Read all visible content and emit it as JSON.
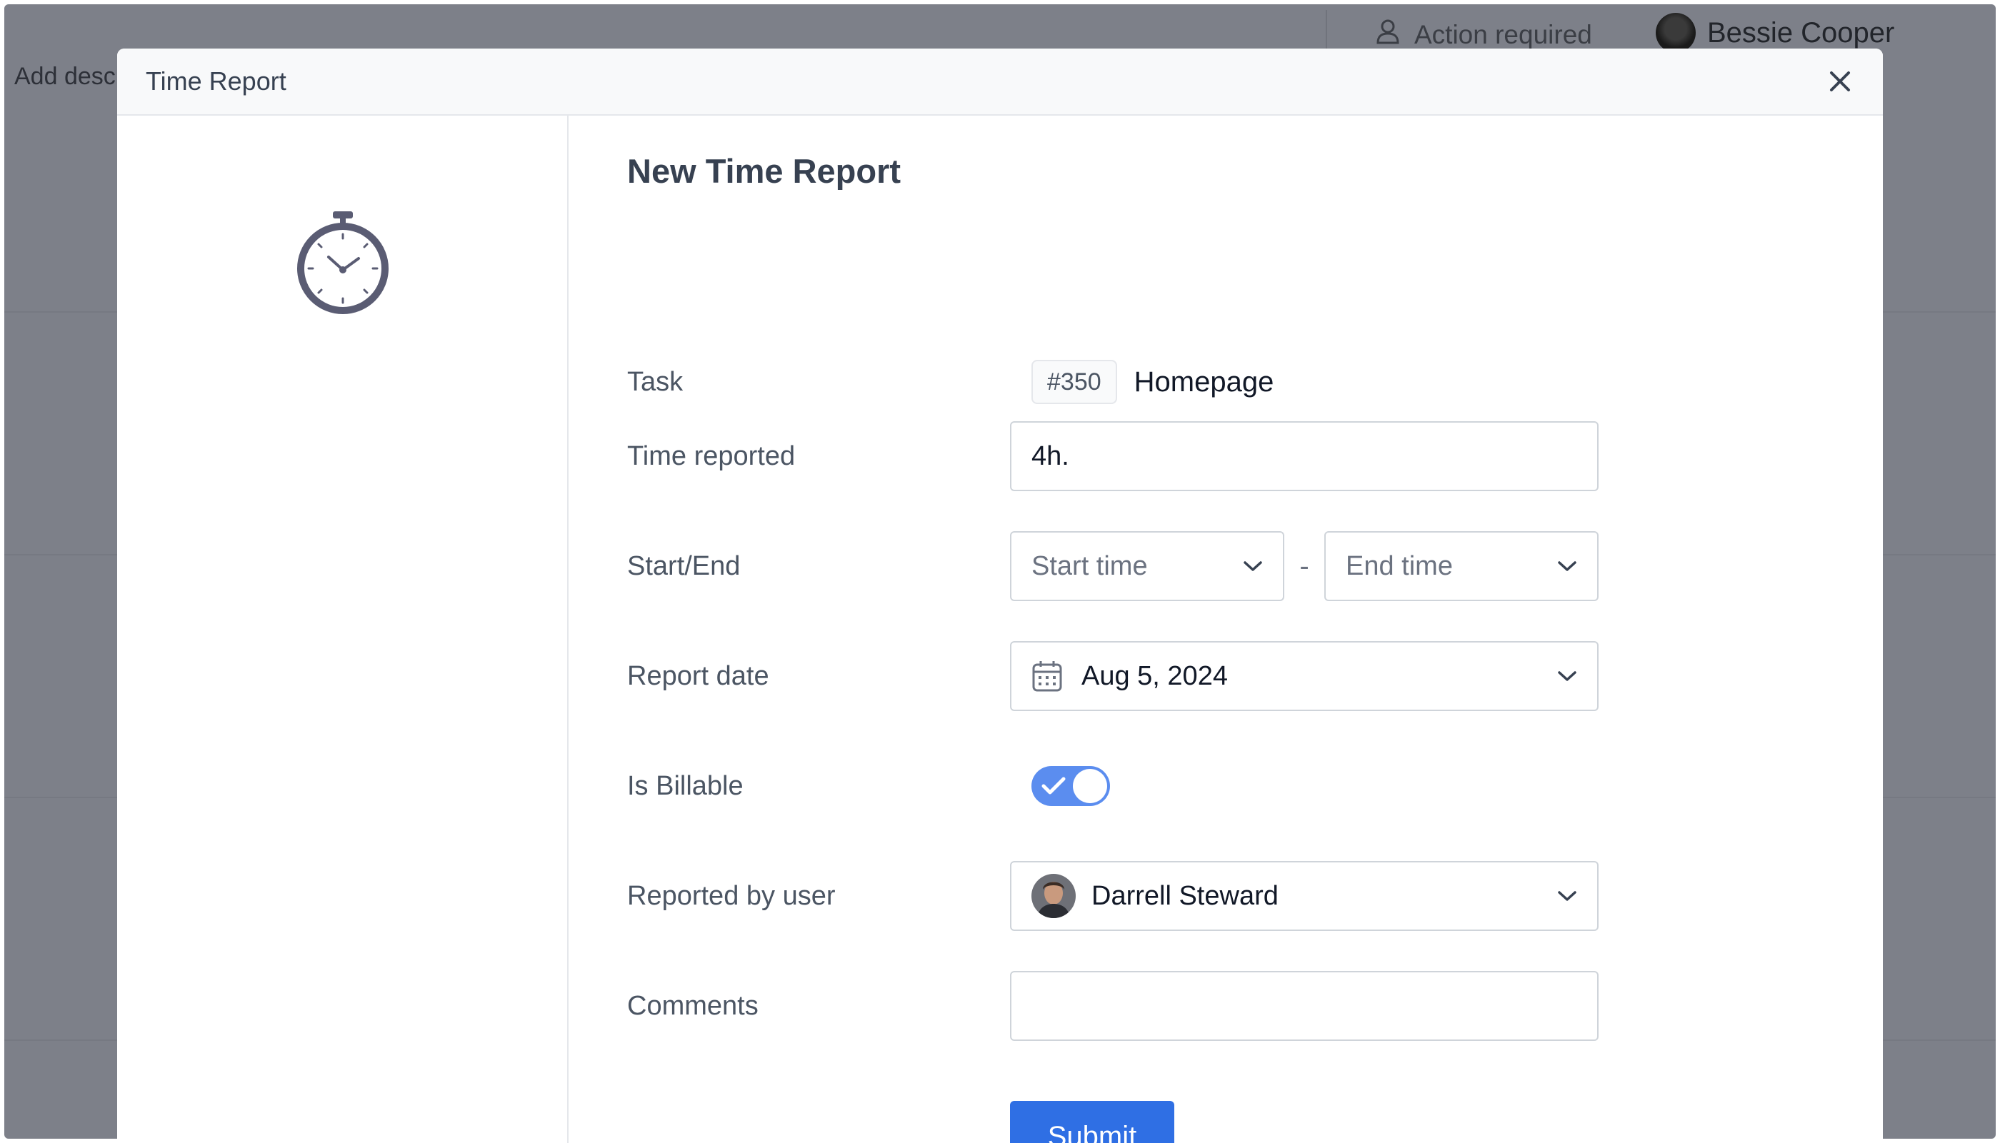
{
  "background": {
    "action_required": "Action required",
    "user_name": "Bessie Cooper",
    "add_description": "Add desc"
  },
  "modal": {
    "title": "Time Report",
    "heading": "New Time Report",
    "form": {
      "task": {
        "label": "Task",
        "id": "#350",
        "name": "Homepage"
      },
      "time_reported": {
        "label": "Time reported",
        "value": "4h."
      },
      "start_end": {
        "label": "Start/End",
        "start_placeholder": "Start time",
        "separator": "-",
        "end_placeholder": "End time"
      },
      "report_date": {
        "label": "Report date",
        "value": "Aug 5, 2024"
      },
      "is_billable": {
        "label": "Is Billable",
        "checked": true
      },
      "reported_by": {
        "label": "Reported by user",
        "value": "Darrell Steward"
      },
      "comments": {
        "label": "Comments",
        "value": ""
      },
      "submit_label": "Submit"
    }
  },
  "colors": {
    "primary": "#2f6fe4",
    "toggle_on": "#5b8def",
    "overlay": "#7d8089"
  },
  "icons": [
    "user-outline-icon",
    "close-icon",
    "stopwatch-icon",
    "chevron-down-icon",
    "calendar-icon",
    "check-icon"
  ]
}
